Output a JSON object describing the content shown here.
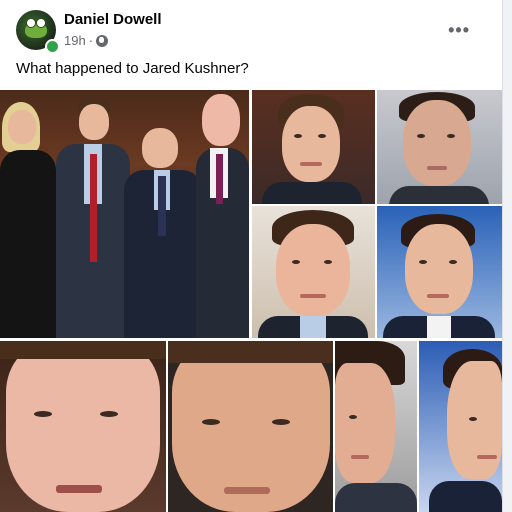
{
  "post": {
    "author": "Daniel Dowell",
    "time": "19h",
    "separator": "·",
    "caption": "What happened to Jared Kushner?",
    "more_label": "•••"
  },
  "icons": {
    "avatar": "frog-avatar",
    "audience": "globe-icon",
    "menu": "more-options-icon"
  },
  "colors": {
    "online": "#31a24c",
    "secondary_text": "#65676b"
  }
}
